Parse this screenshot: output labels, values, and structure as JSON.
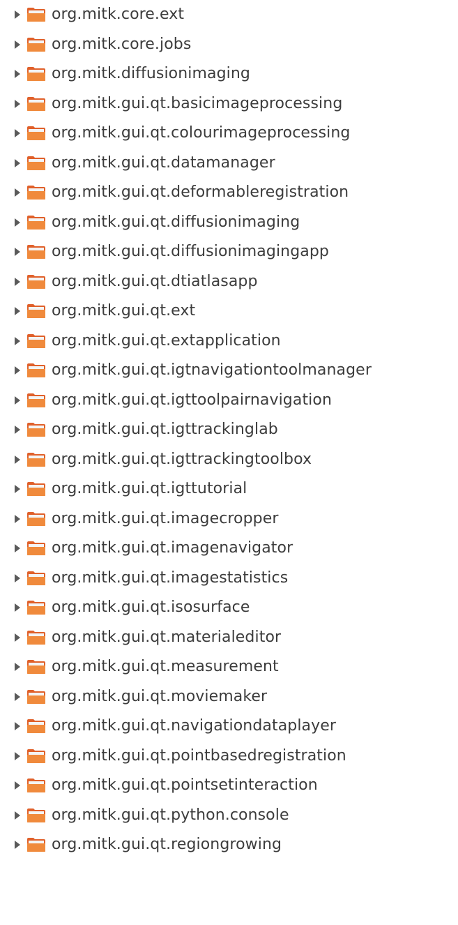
{
  "tree": {
    "items": [
      {
        "label": "org.mitk.core.ext",
        "expander_icon": "triangle-right-icon",
        "icon": "folder-icon"
      },
      {
        "label": "org.mitk.core.jobs",
        "expander_icon": "triangle-right-icon",
        "icon": "folder-icon"
      },
      {
        "label": "org.mitk.diffusionimaging",
        "expander_icon": "triangle-right-icon",
        "icon": "folder-icon"
      },
      {
        "label": "org.mitk.gui.qt.basicimageprocessing",
        "expander_icon": "triangle-right-icon",
        "icon": "folder-icon"
      },
      {
        "label": "org.mitk.gui.qt.colourimageprocessing",
        "expander_icon": "triangle-right-icon",
        "icon": "folder-icon"
      },
      {
        "label": "org.mitk.gui.qt.datamanager",
        "expander_icon": "triangle-right-icon",
        "icon": "folder-icon"
      },
      {
        "label": "org.mitk.gui.qt.deformableregistration",
        "expander_icon": "triangle-right-icon",
        "icon": "folder-icon"
      },
      {
        "label": "org.mitk.gui.qt.diffusionimaging",
        "expander_icon": "triangle-right-icon",
        "icon": "folder-icon"
      },
      {
        "label": "org.mitk.gui.qt.diffusionimagingapp",
        "expander_icon": "triangle-right-icon",
        "icon": "folder-icon"
      },
      {
        "label": "org.mitk.gui.qt.dtiatlasapp",
        "expander_icon": "triangle-right-icon",
        "icon": "folder-icon"
      },
      {
        "label": "org.mitk.gui.qt.ext",
        "expander_icon": "triangle-right-icon",
        "icon": "folder-icon"
      },
      {
        "label": "org.mitk.gui.qt.extapplication",
        "expander_icon": "triangle-right-icon",
        "icon": "folder-icon"
      },
      {
        "label": "org.mitk.gui.qt.igtnavigationtoolmanager",
        "expander_icon": "triangle-right-icon",
        "icon": "folder-icon"
      },
      {
        "label": "org.mitk.gui.qt.igttoolpairnavigation",
        "expander_icon": "triangle-right-icon",
        "icon": "folder-icon"
      },
      {
        "label": "org.mitk.gui.qt.igttrackinglab",
        "expander_icon": "triangle-right-icon",
        "icon": "folder-icon"
      },
      {
        "label": "org.mitk.gui.qt.igttrackingtoolbox",
        "expander_icon": "triangle-right-icon",
        "icon": "folder-icon"
      },
      {
        "label": "org.mitk.gui.qt.igttutorial",
        "expander_icon": "triangle-right-icon",
        "icon": "folder-icon"
      },
      {
        "label": "org.mitk.gui.qt.imagecropper",
        "expander_icon": "triangle-right-icon",
        "icon": "folder-icon"
      },
      {
        "label": "org.mitk.gui.qt.imagenavigator",
        "expander_icon": "triangle-right-icon",
        "icon": "folder-icon"
      },
      {
        "label": "org.mitk.gui.qt.imagestatistics",
        "expander_icon": "triangle-right-icon",
        "icon": "folder-icon"
      },
      {
        "label": "org.mitk.gui.qt.isosurface",
        "expander_icon": "triangle-right-icon",
        "icon": "folder-icon"
      },
      {
        "label": "org.mitk.gui.qt.materialeditor",
        "expander_icon": "triangle-right-icon",
        "icon": "folder-icon"
      },
      {
        "label": "org.mitk.gui.qt.measurement",
        "expander_icon": "triangle-right-icon",
        "icon": "folder-icon"
      },
      {
        "label": "org.mitk.gui.qt.moviemaker",
        "expander_icon": "triangle-right-icon",
        "icon": "folder-icon"
      },
      {
        "label": "org.mitk.gui.qt.navigationdataplayer",
        "expander_icon": "triangle-right-icon",
        "icon": "folder-icon"
      },
      {
        "label": "org.mitk.gui.qt.pointbasedregistration",
        "expander_icon": "triangle-right-icon",
        "icon": "folder-icon"
      },
      {
        "label": "org.mitk.gui.qt.pointsetinteraction",
        "expander_icon": "triangle-right-icon",
        "icon": "folder-icon"
      },
      {
        "label": "org.mitk.gui.qt.python.console",
        "expander_icon": "triangle-right-icon",
        "icon": "folder-icon"
      },
      {
        "label": "org.mitk.gui.qt.regiongrowing",
        "expander_icon": "triangle-right-icon",
        "icon": "folder-icon"
      }
    ]
  },
  "colors": {
    "background": "#ffffff",
    "text": "#3c3c3c",
    "expander": "#5a5a5a",
    "folder_body": "#e0602a",
    "folder_front": "#f08a3c",
    "folder_paper": "#f4f4f4"
  }
}
